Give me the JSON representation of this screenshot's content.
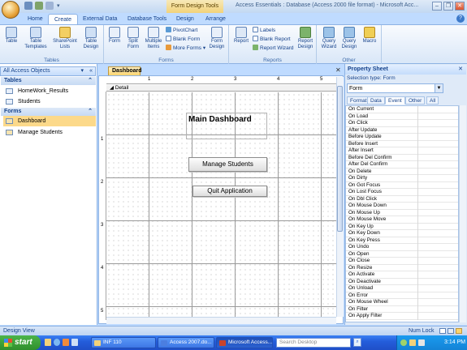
{
  "window": {
    "title": "Access Essentials : Database (Access 2000 file format) - Microsoft Acc...",
    "context_tab_group": "Form Design Tools"
  },
  "ribbon_tabs": [
    {
      "label": "Home",
      "active": false
    },
    {
      "label": "Create",
      "active": true
    },
    {
      "label": "External Data",
      "active": false
    },
    {
      "label": "Database Tools",
      "active": false
    },
    {
      "label": "Design",
      "active": false
    },
    {
      "label": "Arrange",
      "active": false
    }
  ],
  "ribbon": {
    "tables": {
      "label": "Tables",
      "buttons": [
        "Table",
        "Table Templates",
        "SharePoint Lists",
        "Table Design"
      ]
    },
    "forms": {
      "label": "Forms",
      "buttons": [
        "Form",
        "Split Form",
        "Multiple Items"
      ],
      "small": [
        "PivotChart",
        "Blank Form",
        "More Forms"
      ],
      "design": "Form Design"
    },
    "reports": {
      "label": "Reports",
      "buttons": [
        "Report"
      ],
      "small": [
        "Labels",
        "Blank Report",
        "Report Wizard"
      ],
      "design": "Report Design"
    },
    "other": {
      "label": "Other",
      "buttons": [
        "Query Wizard",
        "Query Design",
        "Macro"
      ]
    }
  },
  "nav_pane": {
    "header": "All Access Objects",
    "sections": [
      {
        "title": "Tables",
        "items": [
          "HomeWork_Results",
          "Students"
        ]
      },
      {
        "title": "Forms",
        "items": [
          "Dashboard",
          "Manage Students"
        ]
      }
    ],
    "selected": "Dashboard"
  },
  "document": {
    "tab": "Dashboard",
    "section": "Detail",
    "ruler_top": [
      "1",
      "2",
      "3",
      "4",
      "5"
    ],
    "ruler_left": [
      "1",
      "2",
      "3",
      "4",
      "5"
    ],
    "form_title": "Main Dashboard",
    "buttons": [
      "Manage Students",
      "Quit Application"
    ]
  },
  "property_sheet": {
    "title": "Property Sheet",
    "selection_type": "Selection type:  Form",
    "selected_object": "Form",
    "tabs": [
      {
        "label": "Format",
        "active": false
      },
      {
        "label": "Data",
        "active": false
      },
      {
        "label": "Event",
        "active": true
      },
      {
        "label": "Other",
        "active": false
      },
      {
        "label": "All",
        "active": false
      }
    ],
    "events": [
      "On Current",
      "On Load",
      "On Click",
      "After Update",
      "Before Update",
      "Before Insert",
      "After Insert",
      "Before Del Confirm",
      "After Del Confirm",
      "On Delete",
      "On Dirty",
      "On Got Focus",
      "On Lost Focus",
      "On Dbl Click",
      "On Mouse Down",
      "On Mouse Up",
      "On Mouse Move",
      "On Key Up",
      "On Key Down",
      "On Key Press",
      "On Undo",
      "On Open",
      "On Close",
      "On Resize",
      "On Activate",
      "On Deactivate",
      "On Unload",
      "On Error",
      "On Mouse Wheel",
      "On Filter",
      "On Apply Filter"
    ]
  },
  "status_bar": {
    "left": "Design View",
    "right": "Num Lock"
  },
  "taskbar": {
    "start": "start",
    "items": [
      {
        "label": "INF 110",
        "active": false
      },
      {
        "label": "Access 2007.do...",
        "active": false
      },
      {
        "label": "Microsoft Access...",
        "active": true
      }
    ],
    "search_placeholder": "Search Desktop",
    "clock": "3:14 PM"
  },
  "colors": {
    "ribbon_bg": "#bfdbff",
    "active_doc_tab": "#fbd46e",
    "selected_nav": "#fcd98a",
    "taskbar": "#245edb",
    "start": "#2f8f2c"
  }
}
